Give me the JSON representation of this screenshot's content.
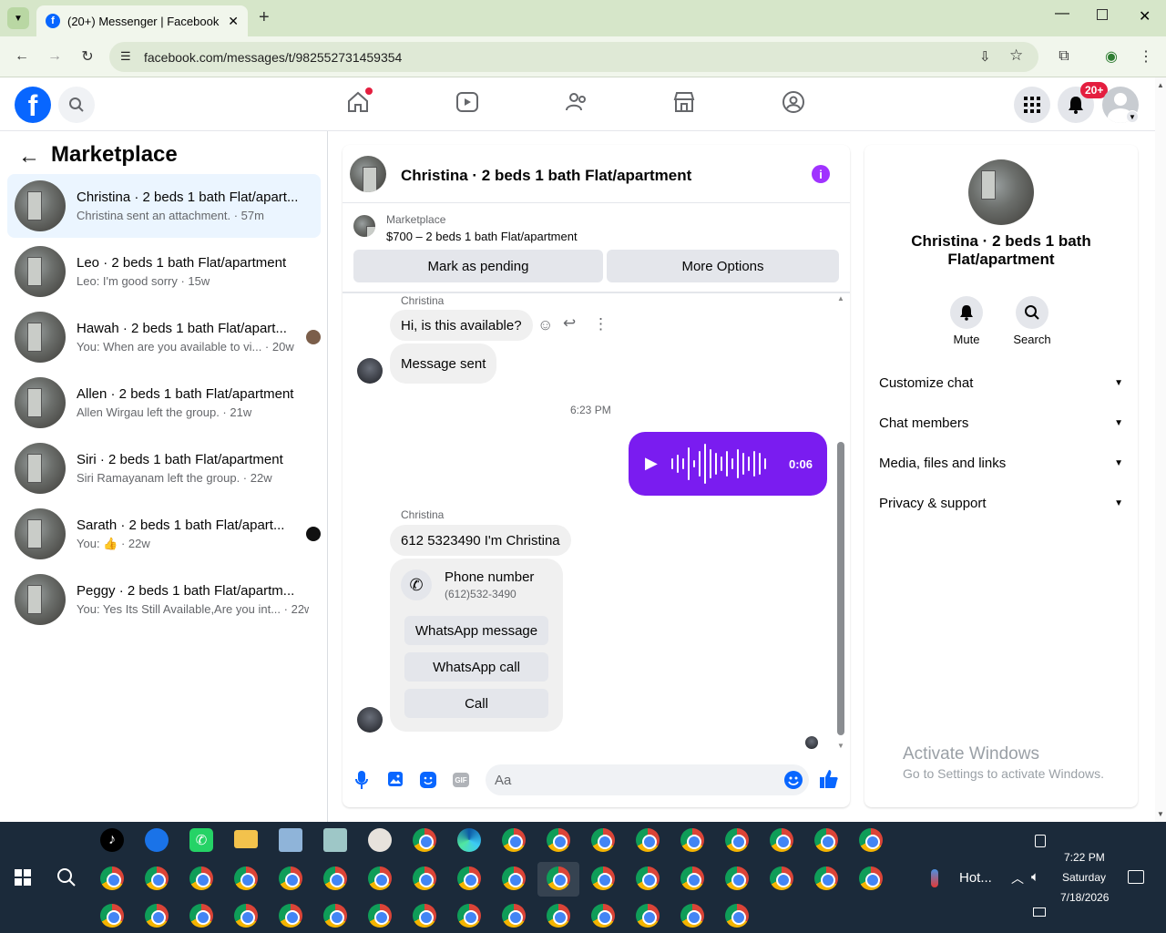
{
  "browser": {
    "tab_title": "(20+) Messenger | Facebook",
    "url": "facebook.com/messages/t/982552731459354"
  },
  "fb_header": {
    "notifications_badge": "20+"
  },
  "sidebar": {
    "title": "Marketplace",
    "conversations": [
      {
        "name": "Christina · 2 beds 1 bath Flat/apart...",
        "preview": "Christina sent an attachment. · 57m"
      },
      {
        "name": "Leo · 2 beds 1 bath Flat/apartment",
        "preview": "Leo: I'm good sorry · 15w"
      },
      {
        "name": "Hawah · 2 beds 1 bath Flat/apart...",
        "preview": "You: When are you available to vi... · 20w"
      },
      {
        "name": "Allen · 2 beds 1 bath Flat/apartment",
        "preview": "Allen Wirgau left the group. · 21w"
      },
      {
        "name": "Siri · 2 beds 1 bath Flat/apartment",
        "preview": "Siri Ramayanam left the group. · 22w"
      },
      {
        "name": "Sarath · 2 beds 1 bath Flat/apart...",
        "preview": "You: 👍 · 22w"
      },
      {
        "name": "Peggy · 2 beds 1 bath Flat/apartm...",
        "preview": "You: Yes Its Still Available,Are you int... · 22w"
      }
    ]
  },
  "chat": {
    "title": "Christina · 2 beds 1 bath Flat/apartment",
    "listing_label": "Marketplace",
    "listing_price": "$700 – 2 beds 1 bath Flat/apartment",
    "mark_pending": "Mark as pending",
    "more_options": "More Options",
    "sender1": "Christina",
    "msg1": "Hi, is this available?",
    "msg2": "Message sent",
    "timestamp": "6:23 PM",
    "voice_duration": "0:06",
    "sender2": "Christina",
    "msg3": "612 5323490 I'm Christina",
    "phone_title": "Phone number",
    "phone_value": "(612)532-3490",
    "whatsapp_message": "WhatsApp message",
    "whatsapp_call": "WhatsApp call",
    "call": "Call",
    "input_placeholder": "Aa",
    "accent": "#7a1cf0"
  },
  "info_panel": {
    "name": "Christina · 2 beds 1 bath Flat/apartment",
    "mute": "Mute",
    "search": "Search",
    "sections": [
      "Customize chat",
      "Chat members",
      "Media, files and links",
      "Privacy & support"
    ],
    "watermark_title": "Activate Windows",
    "watermark_sub": "Go to Settings to activate Windows."
  },
  "taskbar": {
    "weather": "Hot...",
    "time": "7:22 PM",
    "day": "Saturday",
    "date": "7/18/2026"
  }
}
